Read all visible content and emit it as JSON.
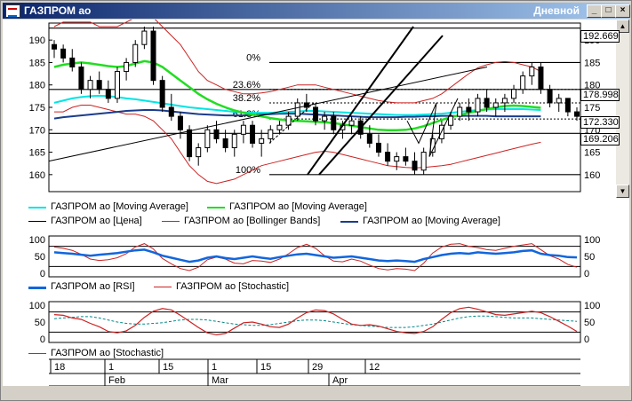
{
  "window": {
    "title": "ГАЗПРОМ ао",
    "period": "Дневной"
  },
  "colors": {
    "ma_cyan": "#00e5e5",
    "ma_green": "#22dd22",
    "price": "#000000",
    "bollinger": "#cc2222",
    "ma_blue": "#1a3c8c",
    "rsi": "#1166dd",
    "stoch": "#cc2222",
    "stoch_signal": "#008888"
  },
  "main_chart": {
    "y_ticks": [
      "190",
      "185",
      "180",
      "175",
      "170",
      "165",
      "160"
    ],
    "fib_levels": [
      {
        "label": "0%"
      },
      {
        "label": "23.6%"
      },
      {
        "label": "38.2%"
      },
      {
        "label": "61.8%"
      },
      {
        "label": "100%"
      }
    ],
    "price_boxes": [
      {
        "value": "192.669"
      },
      {
        "value": "178.998"
      },
      {
        "value": "172.330"
      },
      {
        "value": "169.206"
      }
    ]
  },
  "legend": {
    "row1": [
      {
        "label": "ГАЗПРОМ ао [Moving Average]"
      },
      {
        "label": "ГАЗПРОМ ао [Moving Average]"
      }
    ],
    "row2": [
      {
        "label": "ГАЗПРОМ ао [Цена]"
      },
      {
        "label": "ГАЗПРОМ ао [Bollinger Bands]"
      },
      {
        "label": "ГАЗПРОМ ао [Moving Average]"
      }
    ]
  },
  "rsi_panel": {
    "ticks": [
      "100",
      "50",
      "0"
    ],
    "legend": [
      {
        "label": "ГАЗПРОМ ао [RSI]"
      },
      {
        "label": "ГАЗПРОМ ао [Stochastic]"
      }
    ]
  },
  "stoch_panel": {
    "ticks": [
      "100",
      "50",
      "0"
    ],
    "legend": [
      {
        "label": "ГАЗПРОМ ао [Stochastic]"
      }
    ]
  },
  "time_axis": {
    "days": [
      "18",
      "1",
      "15",
      "1",
      "15",
      "29",
      "12"
    ],
    "months": [
      "Feb",
      "Mar",
      "Apr"
    ]
  },
  "chart_data": {
    "type": "candlestick",
    "y_range": [
      157,
      193
    ],
    "candles": [
      [
        189,
        190,
        186,
        188
      ],
      [
        188,
        189,
        185,
        186
      ],
      [
        186,
        188,
        183,
        184
      ],
      [
        184,
        185,
        178,
        179
      ],
      [
        179,
        182,
        177,
        181
      ],
      [
        181,
        183,
        178,
        179
      ],
      [
        179,
        181,
        176,
        177
      ],
      [
        177,
        184,
        176,
        183
      ],
      [
        183,
        186,
        181,
        185
      ],
      [
        185,
        190,
        184,
        189
      ],
      [
        189,
        193,
        188,
        192
      ],
      [
        192,
        193,
        180,
        181
      ],
      [
        181,
        182,
        174,
        175
      ],
      [
        175,
        178,
        172,
        173
      ],
      [
        173,
        174,
        168,
        170
      ],
      [
        170,
        171,
        163,
        164
      ],
      [
        164,
        167,
        162,
        166
      ],
      [
        166,
        171,
        165,
        170
      ],
      [
        170,
        172,
        167,
        168
      ],
      [
        168,
        170,
        165,
        166
      ],
      [
        166,
        170,
        164,
        169
      ],
      [
        169,
        172,
        167,
        171
      ],
      [
        171,
        172,
        166,
        167
      ],
      [
        167,
        170,
        164,
        168
      ],
      [
        168,
        171,
        167,
        170
      ],
      [
        170,
        172,
        169,
        171
      ],
      [
        171,
        174,
        170,
        173
      ],
      [
        173,
        177,
        172,
        176
      ],
      [
        176,
        178,
        174,
        175
      ],
      [
        175,
        176,
        171,
        172
      ],
      [
        172,
        174,
        170,
        173
      ],
      [
        173,
        174,
        169,
        170
      ],
      [
        170,
        172,
        168,
        171
      ],
      [
        171,
        173,
        169,
        172
      ],
      [
        172,
        173,
        168,
        169
      ],
      [
        169,
        171,
        166,
        167
      ],
      [
        167,
        169,
        164,
        165
      ],
      [
        165,
        167,
        162,
        163
      ],
      [
        163,
        165,
        161,
        164
      ],
      [
        164,
        166,
        162,
        163
      ],
      [
        163,
        165,
        160,
        161
      ],
      [
        161,
        166,
        160,
        165
      ],
      [
        165,
        169,
        164,
        168
      ],
      [
        168,
        172,
        167,
        171
      ],
      [
        171,
        174,
        170,
        173
      ],
      [
        173,
        176,
        172,
        175
      ],
      [
        175,
        177,
        172,
        174
      ],
      [
        174,
        178,
        173,
        177
      ],
      [
        177,
        179,
        174,
        175
      ],
      [
        175,
        177,
        173,
        176
      ],
      [
        176,
        178,
        174,
        177
      ],
      [
        177,
        180,
        176,
        179
      ],
      [
        179,
        183,
        178,
        182
      ],
      [
        182,
        185,
        180,
        184
      ],
      [
        184,
        185,
        178,
        179
      ],
      [
        179,
        180,
        175,
        176
      ],
      [
        176,
        178,
        174,
        177
      ],
      [
        177,
        177,
        173,
        174
      ],
      [
        174,
        175,
        172,
        173
      ]
    ],
    "ma_cyan": [
      176,
      176.5,
      177,
      177.3,
      177.5,
      177.6,
      177.5,
      177.3,
      177,
      176.8,
      176.5,
      176.2,
      175.9,
      175.6,
      175.3,
      175,
      174.8,
      174.6,
      174.4,
      174.2,
      174,
      173.9,
      173.8,
      173.8,
      173.8,
      173.9,
      174,
      174.1,
      174.2,
      174.2,
      174.1,
      174,
      173.9,
      173.8,
      173.7,
      173.6,
      173.5,
      173.4,
      173.3,
      173.3,
      173.3,
      173.4,
      173.5,
      173.6,
      173.8,
      174,
      174.2,
      174.4,
      174.5,
      174.6,
      174.6,
      174.6,
      174.6,
      174.5,
      174.4
    ],
    "ma_green": [
      184,
      184.5,
      184.8,
      185,
      184.8,
      184.5,
      184.2,
      184,
      184.2,
      184.8,
      185.3,
      185,
      184,
      182.5,
      181,
      179.5,
      178,
      176.8,
      175.8,
      175,
      174.3,
      173.8,
      173.4,
      173,
      172.6,
      172.3,
      172.1,
      172,
      171.9,
      171.8,
      171.7,
      171.5,
      171.2,
      170.9,
      170.6,
      170.3,
      170,
      169.9,
      169.9,
      170,
      170.3,
      170.8,
      171.5,
      172.2,
      172.8,
      173.3,
      173.8,
      174.2,
      174.6,
      175,
      175.3,
      175.4,
      175.3,
      175.1,
      174.9
    ],
    "ma_blue": [
      172.5,
      172.8,
      173,
      173.2,
      173.4,
      173.6,
      173.8,
      174,
      174.2,
      174.3,
      174.4,
      174.4,
      174.3,
      174.1,
      173.9,
      173.7,
      173.5,
      173.4,
      173.3,
      173.2,
      173.2,
      173.2,
      173.3,
      173.4,
      173.5,
      173.6,
      173.6,
      173.6,
      173.5,
      173.4,
      173.3,
      173.2,
      173.1,
      173,
      172.9,
      172.8,
      172.8,
      172.8,
      172.8,
      172.9,
      172.9,
      173,
      173,
      173.1,
      173.1,
      173.1,
      173.1,
      173.1,
      173.1,
      173,
      173,
      173,
      173,
      173,
      173
    ],
    "bb_upper": [
      193,
      194,
      194,
      194,
      194,
      193,
      193,
      193,
      194,
      195,
      196,
      195,
      193,
      191,
      189,
      186,
      183,
      181,
      180,
      179,
      178.5,
      178,
      178,
      178.2,
      178.5,
      179,
      179.5,
      180,
      180,
      180,
      179.5,
      179,
      178.5,
      178,
      177.5,
      177,
      176.5,
      176.2,
      176,
      176,
      176,
      176.5,
      177,
      178,
      179.5,
      181,
      182.5,
      183.8,
      184.5,
      185,
      185.2,
      185,
      184.5,
      184,
      183
    ],
    "bb_lower": [
      174,
      174,
      175,
      175.5,
      175.5,
      175,
      174.5,
      174,
      173.5,
      173.5,
      173,
      172,
      170,
      168,
      165,
      162,
      160,
      158.5,
      158,
      158.5,
      159,
      160,
      161,
      162,
      162.5,
      163,
      163.5,
      164,
      164.5,
      165,
      165.2,
      165,
      164.5,
      164,
      163.5,
      163,
      162.5,
      162,
      161.8,
      161.6,
      161.5,
      161.6,
      161.8,
      162,
      162.3,
      162.8,
      163.3,
      163.8,
      164.3,
      164.8,
      165.3,
      165.8,
      166.3,
      166.8,
      167.2
    ],
    "rsi": [
      62,
      60,
      58,
      55,
      52,
      55,
      57,
      60,
      64,
      68,
      70,
      62,
      52,
      46,
      40,
      34,
      38,
      46,
      50,
      45,
      42,
      46,
      50,
      46,
      43,
      48,
      52,
      56,
      58,
      54,
      50,
      46,
      48,
      50,
      46,
      42,
      38,
      36,
      38,
      36,
      34,
      42,
      48,
      54,
      58,
      60,
      58,
      62,
      60,
      58,
      60,
      62,
      66,
      68,
      58,
      54,
      52,
      48,
      47
    ],
    "stoch_a": [
      78,
      74,
      68,
      56,
      42,
      38,
      40,
      46,
      58,
      78,
      88,
      72,
      44,
      28,
      14,
      8,
      18,
      40,
      48,
      42,
      30,
      28,
      38,
      36,
      32,
      42,
      58,
      76,
      86,
      74,
      52,
      36,
      34,
      42,
      36,
      24,
      14,
      10,
      14,
      12,
      8,
      30,
      60,
      78,
      86,
      88,
      80,
      76,
      70,
      68,
      74,
      80,
      84,
      88,
      70,
      52,
      42,
      26,
      18
    ],
    "stoch_b": [
      72,
      70,
      62,
      58,
      46,
      36,
      22,
      18,
      24,
      40,
      64,
      82,
      90,
      86,
      70,
      52,
      34,
      18,
      12,
      16,
      32,
      48,
      50,
      44,
      36,
      34,
      44,
      62,
      78,
      86,
      84,
      74,
      58,
      44,
      40,
      42,
      38,
      30,
      22,
      18,
      16,
      22,
      36,
      58,
      78,
      90,
      94,
      88,
      80,
      72,
      70,
      74,
      78,
      82,
      78,
      66,
      52,
      38,
      22
    ],
    "stoch_sig": [
      60,
      62,
      64,
      66,
      66,
      62,
      56,
      50,
      46,
      44,
      44,
      46,
      48,
      52,
      56,
      58,
      58,
      56,
      52,
      48,
      44,
      42,
      40,
      40,
      42,
      46,
      50,
      54,
      56,
      56,
      54,
      50,
      46,
      42,
      40,
      38,
      36,
      34,
      34,
      34,
      36,
      40,
      44,
      50,
      56,
      62,
      66,
      68,
      68,
      66,
      64,
      62,
      62,
      62,
      60,
      58,
      56,
      54,
      52
    ]
  }
}
